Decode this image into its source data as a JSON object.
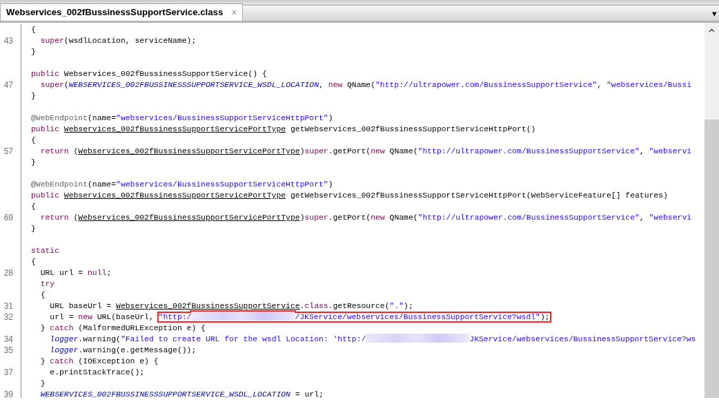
{
  "tabs": [
    {
      "title": "Webservices_002fBussinessSupportService.class",
      "selected": true,
      "close": "×"
    }
  ],
  "tab_menu": "▾",
  "lines": [
    {
      "segments": [
        {
          "kind": "plain",
          "text": "{"
        }
      ]
    },
    {
      "number": "43",
      "segments": [
        {
          "kind": "keyword",
          "text": "  super"
        },
        {
          "kind": "plain",
          "text": "(wsdlLocation, serviceName);"
        }
      ]
    },
    {
      "segments": [
        {
          "kind": "plain",
          "text": "}"
        }
      ]
    },
    {
      "blank_before": true,
      "segments": [
        {
          "kind": "keyword",
          "text": "public"
        },
        {
          "kind": "plain",
          "text": " Webservices_002fBussinessSupportService() {"
        }
      ]
    },
    {
      "number": "47",
      "segments": [
        {
          "kind": "keyword",
          "text": "  super"
        },
        {
          "kind": "plain",
          "text": "("
        },
        {
          "kind": "field",
          "text": "WEBSERVICES_002FBUSSINESSSUPPORTSERVICE_WSDL_LOCATION"
        },
        {
          "kind": "plain",
          "text": ", "
        },
        {
          "kind": "keyword",
          "text": "new"
        },
        {
          "kind": "plain",
          "text": " QName("
        },
        {
          "kind": "string",
          "text": "\"http://ultrapower.com/BussinessSupportService\""
        },
        {
          "kind": "plain",
          "text": ", "
        },
        {
          "kind": "string",
          "text": "\"webservices/Bussi"
        }
      ]
    },
    {
      "segments": [
        {
          "kind": "plain",
          "text": "}"
        }
      ]
    },
    {
      "blank_before": true,
      "segments": [
        {
          "kind": "annotation",
          "text": "@WebEndpoint"
        },
        {
          "kind": "plain",
          "text": "(name="
        },
        {
          "kind": "string",
          "text": "\"webservices/BussinessSupportServiceHttpPort\""
        },
        {
          "kind": "plain",
          "text": ")"
        }
      ]
    },
    {
      "segments": [
        {
          "kind": "keyword",
          "text": "public "
        },
        {
          "kind": "type",
          "text": "Webservices_002fBussinessSupportServicePortType"
        },
        {
          "kind": "plain",
          "text": " getWebservices_002fBussinessSupportServiceHttpPort()"
        }
      ]
    },
    {
      "segments": [
        {
          "kind": "plain",
          "text": "{"
        }
      ]
    },
    {
      "number": "57",
      "segments": [
        {
          "kind": "keyword",
          "text": "  return"
        },
        {
          "kind": "plain",
          "text": " ("
        },
        {
          "kind": "type",
          "text": "Webservices_002fBussinessSupportServicePortType"
        },
        {
          "kind": "plain",
          "text": ")"
        },
        {
          "kind": "keyword",
          "text": "super"
        },
        {
          "kind": "plain",
          "text": ".getPort("
        },
        {
          "kind": "keyword",
          "text": "new"
        },
        {
          "kind": "plain",
          "text": " QName("
        },
        {
          "kind": "string",
          "text": "\"http://ultrapower.com/BussinessSupportService\""
        },
        {
          "kind": "plain",
          "text": ", "
        },
        {
          "kind": "string",
          "text": "\"webservi"
        }
      ]
    },
    {
      "segments": [
        {
          "kind": "plain",
          "text": "}"
        }
      ]
    },
    {
      "blank_before": true,
      "segments": [
        {
          "kind": "annotation",
          "text": "@WebEndpoint"
        },
        {
          "kind": "plain",
          "text": "(name="
        },
        {
          "kind": "string",
          "text": "\"webservices/BussinessSupportServiceHttpPort\""
        },
        {
          "kind": "plain",
          "text": ")"
        }
      ]
    },
    {
      "segments": [
        {
          "kind": "keyword",
          "text": "public "
        },
        {
          "kind": "type",
          "text": "Webservices_002fBussinessSupportServicePortType"
        },
        {
          "kind": "plain",
          "text": " getWebservices_002fBussinessSupportServiceHttpPort(WebServiceFeature[] features)"
        }
      ]
    },
    {
      "segments": [
        {
          "kind": "plain",
          "text": "{"
        }
      ]
    },
    {
      "number": "69",
      "segments": [
        {
          "kind": "keyword",
          "text": "  return"
        },
        {
          "kind": "plain",
          "text": " ("
        },
        {
          "kind": "type",
          "text": "Webservices_002fBussinessSupportServicePortType"
        },
        {
          "kind": "plain",
          "text": ")"
        },
        {
          "kind": "keyword",
          "text": "super"
        },
        {
          "kind": "plain",
          "text": ".getPort("
        },
        {
          "kind": "keyword",
          "text": "new"
        },
        {
          "kind": "plain",
          "text": " QName("
        },
        {
          "kind": "string",
          "text": "\"http://ultrapower.com/BussinessSupportService\""
        },
        {
          "kind": "plain",
          "text": ", "
        },
        {
          "kind": "string",
          "text": "\"webservi"
        }
      ]
    },
    {
      "segments": [
        {
          "kind": "plain",
          "text": "}"
        }
      ]
    },
    {
      "blank_before": true,
      "segments": [
        {
          "kind": "keyword",
          "text": "static"
        }
      ]
    },
    {
      "segments": [
        {
          "kind": "plain",
          "text": "{"
        }
      ]
    },
    {
      "number": "28",
      "segments": [
        {
          "kind": "plain",
          "text": "  URL url = "
        },
        {
          "kind": "keyword",
          "text": "null"
        },
        {
          "kind": "plain",
          "text": ";"
        }
      ]
    },
    {
      "segments": [
        {
          "kind": "keyword",
          "text": "  try"
        }
      ]
    },
    {
      "segments": [
        {
          "kind": "plain",
          "text": "  {"
        }
      ]
    },
    {
      "number": "31",
      "segments": [
        {
          "kind": "plain",
          "text": "    URL baseUrl = "
        },
        {
          "kind": "type",
          "text": "Webservices_002fBussinessSupportService"
        },
        {
          "kind": "plain",
          "text": "."
        },
        {
          "kind": "keyword",
          "text": "class"
        },
        {
          "kind": "plain",
          "text": ".getResource("
        },
        {
          "kind": "string",
          "text": "\".\""
        },
        {
          "kind": "plain",
          "text": ");"
        }
      ]
    },
    {
      "number": "32",
      "segments": [
        {
          "kind": "plain",
          "text": "    url = "
        },
        {
          "kind": "keyword",
          "text": "new"
        },
        {
          "kind": "plain",
          "text": " URL(baseUrl, "
        },
        {
          "kind": "group",
          "highlighted": true,
          "segments": [
            {
              "kind": "string",
              "text": "\"http:/"
            },
            {
              "kind": "redacted"
            },
            {
              "kind": "string",
              "text": "/JKService/webservices/BussinessSupportService?wsdl\""
            },
            {
              "kind": "plain",
              "text": ");"
            }
          ]
        }
      ]
    },
    {
      "segments": [
        {
          "kind": "plain",
          "text": "  } "
        },
        {
          "kind": "keyword",
          "text": "catch"
        },
        {
          "kind": "plain",
          "text": " (MalformedURLException e) {"
        }
      ]
    },
    {
      "number": "34",
      "segments": [
        {
          "kind": "field",
          "text": "    logger"
        },
        {
          "kind": "plain",
          "text": ".warning("
        },
        {
          "kind": "string",
          "text": "\"Failed to create URL for the wsdl Location: 'http:/"
        },
        {
          "kind": "redacted"
        },
        {
          "kind": "string",
          "text": "JKService/webservices/BussinessSupportService?ws"
        }
      ]
    },
    {
      "number": "35",
      "segments": [
        {
          "kind": "field",
          "text": "    logger"
        },
        {
          "kind": "plain",
          "text": ".warning(e.getMessage());"
        }
      ]
    },
    {
      "segments": [
        {
          "kind": "plain",
          "text": "  } "
        },
        {
          "kind": "keyword",
          "text": "catch"
        },
        {
          "kind": "plain",
          "text": " (IOException e) {"
        }
      ]
    },
    {
      "number": "37",
      "segments": [
        {
          "kind": "plain",
          "text": "    e.printStackTrace();"
        }
      ]
    },
    {
      "segments": [
        {
          "kind": "plain",
          "text": "  }"
        }
      ]
    },
    {
      "number": "39",
      "segments": [
        {
          "kind": "field",
          "text": "  WEBSERVICES_002FBUSSINESSSUPPORTSERVICE_WSDL_LOCATION"
        },
        {
          "kind": "plain",
          "text": " = url;"
        }
      ]
    }
  ]
}
